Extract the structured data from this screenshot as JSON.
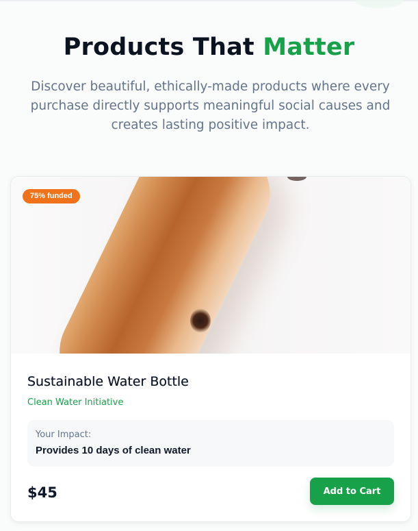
{
  "hero": {
    "title_main": "Products That",
    "title_accent": "Matter",
    "subtitle": "Discover beautiful, ethically-made products where every purchase directly supports meaningful social causes and creates lasting positive impact."
  },
  "product": {
    "badge": "75% funded",
    "funded_percent": 75,
    "image_icon": "water-bottle-photo",
    "name": "Sustainable Water Bottle",
    "cause": "Clean Water Initiative",
    "impact_label": "Your Impact:",
    "impact_value": "Provides 10 days of clean water",
    "price": "$45",
    "cta_label": "Add to Cart"
  },
  "colors": {
    "accent_green": "#17a148",
    "badge_orange": "#f0721a",
    "heading_dark": "#0b1220",
    "muted_text": "#64748b"
  }
}
